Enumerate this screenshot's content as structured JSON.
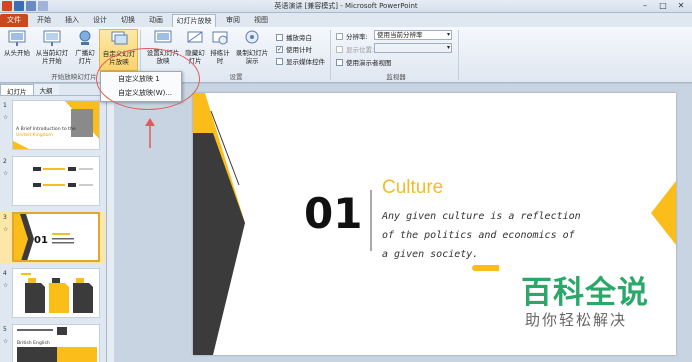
{
  "window": {
    "title": "英语演讲 [兼容模式] - Microsoft PowerPoint",
    "controls": [
      "–",
      "□",
      "✕"
    ]
  },
  "tabs": {
    "file": "文件",
    "items": [
      "开始",
      "插入",
      "设计",
      "切换",
      "动画",
      "幻灯片放映",
      "审阅",
      "视图"
    ],
    "active": "幻灯片放映"
  },
  "ribbon": {
    "start_group": {
      "from_beginning": "从头开始",
      "from_current": "从当前幻灯片开始",
      "broadcast": "广播幻灯片",
      "custom_show": "自定义幻灯片放映",
      "label": "开始放映幻灯片"
    },
    "setup_group": {
      "setup_show": "设置幻灯片放映",
      "hide_slide": "隐藏幻灯片",
      "rehearse": "排练计时",
      "record": "录制幻灯片演示",
      "play_narration": "播放旁白",
      "use_timings": "使用计时",
      "show_media_controls": "显示媒体控件",
      "label": "设置"
    },
    "monitor_group": {
      "resolution_label": "分辨率:",
      "resolution_value": "使用当前分辨率",
      "show_on_label": "显示位置:",
      "presenter_view": "使用演示者视图",
      "label": "监视器"
    }
  },
  "dropdown": {
    "items": [
      "自定义放映 1",
      "自定义放映(W)..."
    ]
  },
  "panel": {
    "tabs": [
      "幻灯片",
      "大纲"
    ],
    "slide_numbers": [
      "1",
      "2",
      "3",
      "4",
      "5"
    ],
    "selected": "3",
    "thumb1": {
      "title": "A Brief Introduction to the",
      "sub": "United Kingdom"
    },
    "thumb5": {
      "title": "British English"
    }
  },
  "slide": {
    "number": "01",
    "heading": "Culture",
    "body_lines": [
      "Any given culture is a reflection",
      "of the politics and economics of",
      "a given society."
    ]
  },
  "watermark": {
    "main": "百科全说",
    "sub": "助你轻松解决"
  },
  "colors": {
    "accent_yellow": "#fbbd1a",
    "dark_shape": "#3b3b3b",
    "heading_yellow": "#f4bc2a",
    "file_tab": "#c9481e",
    "annotation_red": "#e05c5c",
    "watermark_green": "#2aa86a"
  }
}
